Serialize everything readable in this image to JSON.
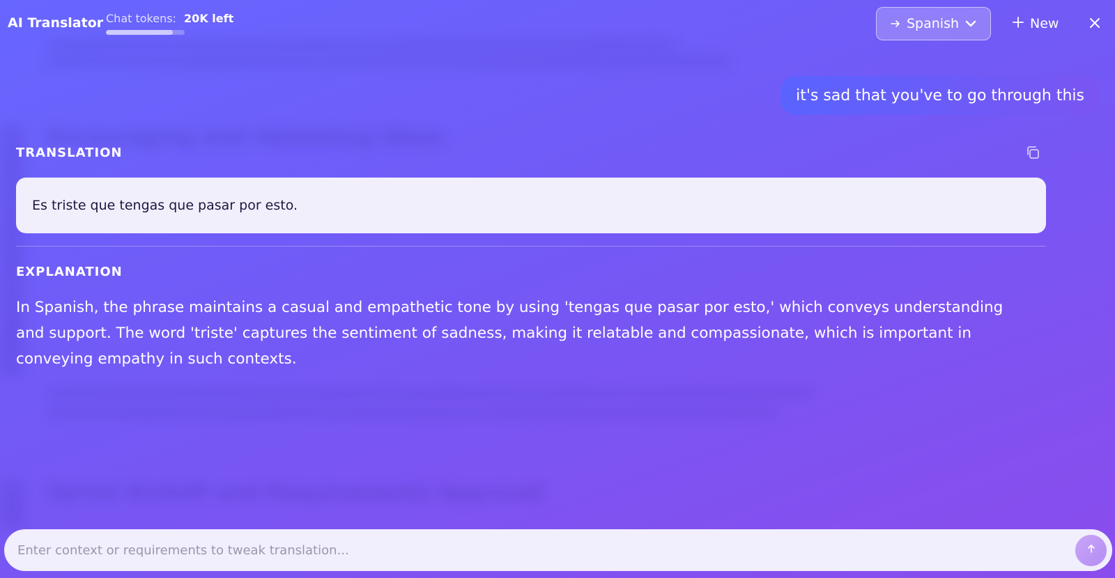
{
  "header": {
    "app_title": "AI Translator",
    "tokens_label": "Chat tokens:",
    "tokens_value": "20K left",
    "tokens_fraction": 0.85,
    "language": "Spanish",
    "new_label": "New"
  },
  "conversation": {
    "user_message": "it's sad that you've to go through this",
    "translation_label": "TRANSLATION",
    "translation_text": "Es triste que tengas que pasar por esto.",
    "explanation_label": "EXPLANATION",
    "explanation_text": "In Spanish, the phrase maintains a casual and empathetic tone by using 'tengas que pasar por esto,' which conveys understanding and support. The word 'triste' captures the sentiment of sadness, making it relatable and compassionate, which is important in conveying empathy in such contexts."
  },
  "background": {
    "heading_1": "Encouraging and Validating Ideas",
    "heading_2": "Sprint Kickoff and Requirements Approval"
  },
  "composer": {
    "placeholder": "Enter context or requirements to tweak translation..."
  },
  "icons": {
    "language": "arrow-right-icon",
    "dropdown": "chevron-down-icon",
    "new": "plus-icon",
    "close": "close-icon",
    "copy": "copy-icon",
    "send": "arrow-up-icon"
  },
  "colors": {
    "background_start": "#6766ff",
    "background_end": "#8a4cec",
    "user_bubble": "#5a63ff",
    "translation_box": "#f2effc",
    "send_button": "#c9a5f7"
  }
}
